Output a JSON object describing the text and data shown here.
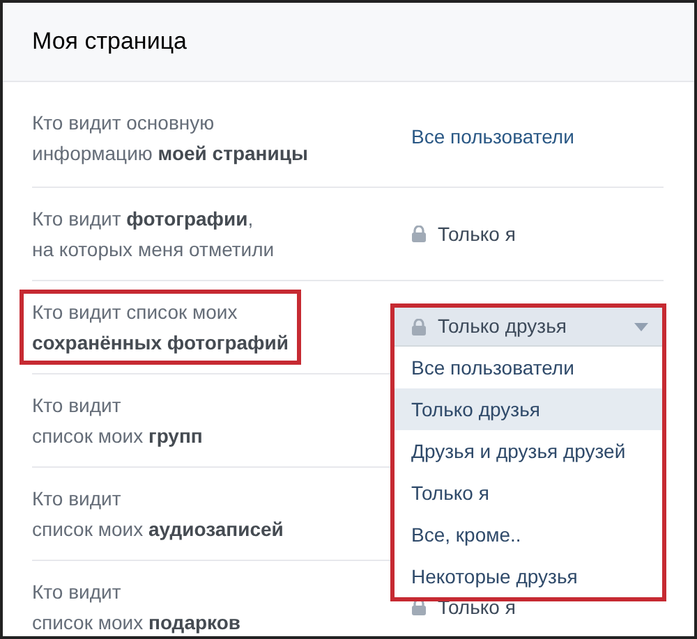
{
  "header": {
    "title": "Моя страница"
  },
  "rows": [
    {
      "label": "Кто видит основную\nинформацию **моей страницы**",
      "value": {
        "text": "Все пользователи",
        "locked": false
      }
    },
    {
      "label": "Кто видит **фотографии**,\nна которых меня отметили",
      "value": {
        "text": "Только я",
        "locked": true
      }
    },
    {
      "label": "Кто видит список моих\n**сохранённых фотографий**",
      "highlighted": true,
      "dropdown": {
        "text": "Только друзья",
        "locked": true,
        "highlighted": true,
        "options": [
          {
            "label": "Все пользователи",
            "selected": false
          },
          {
            "label": "Только друзья",
            "selected": true
          },
          {
            "label": "Друзья и друзья друзей",
            "selected": false
          },
          {
            "label": "Только я",
            "selected": false
          },
          {
            "label": "Все, кроме..",
            "selected": false
          },
          {
            "label": "Некоторые друзья",
            "selected": false
          }
        ]
      }
    },
    {
      "label": "Кто видит\nсписок моих **групп**"
    },
    {
      "label": "Кто видит\nсписок моих **аудиозаписей**"
    },
    {
      "label": "Кто видит\nсписок моих **подарков**",
      "value": {
        "text": "Только я",
        "locked": true
      }
    }
  ]
}
